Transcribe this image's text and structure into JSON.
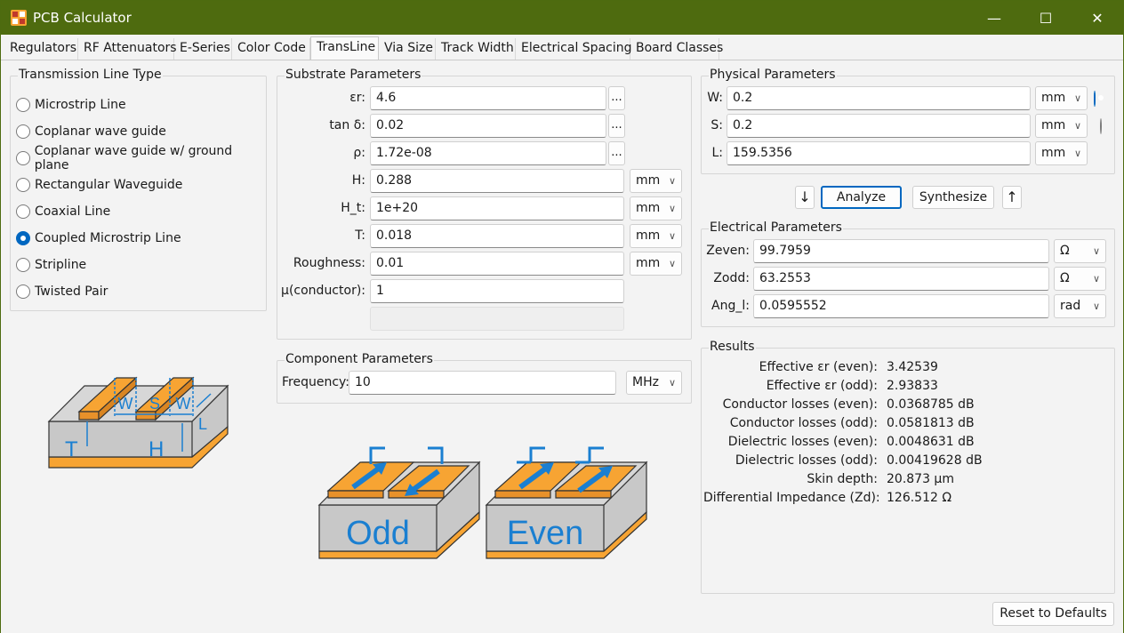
{
  "window": {
    "title": "PCB Calculator",
    "buttons": {
      "minimize": "—",
      "maximize": "☐",
      "close": "✕"
    }
  },
  "tabs": [
    "Regulators",
    "RF Attenuators",
    "E-Series",
    "Color Code",
    "TransLine",
    "Via Size",
    "Track Width",
    "Electrical Spacing",
    "Board Classes"
  ],
  "active_tab": "TransLine",
  "line_type": {
    "title": "Transmission Line Type",
    "options": [
      "Microstrip Line",
      "Coplanar wave guide",
      "Coplanar wave guide w/ ground plane",
      "Rectangular Waveguide",
      "Coaxial Line",
      "Coupled Microstrip Line",
      "Stripline",
      "Twisted Pair"
    ],
    "selected": "Coupled Microstrip Line"
  },
  "diagram_coupled": {
    "w1": "W",
    "s": "S",
    "w2": "W",
    "l": "L",
    "t": "T",
    "h": "H"
  },
  "diagram_modes": {
    "odd": "Odd",
    "even": "Even"
  },
  "substrate": {
    "title": "Substrate Parameters",
    "rows": [
      {
        "label": "εr:",
        "value": "4.6",
        "extra": "..."
      },
      {
        "label": "tan δ:",
        "value": "0.02",
        "extra": "..."
      },
      {
        "label": "ρ:",
        "value": "1.72e-08",
        "extra": "..."
      },
      {
        "label": "H:",
        "value": "0.288",
        "unit": "mm"
      },
      {
        "label": "H_t:",
        "value": "1e+20",
        "unit": "mm"
      },
      {
        "label": "T:",
        "value": "0.018",
        "unit": "mm"
      },
      {
        "label": "Roughness:",
        "value": "0.01",
        "unit": "mm"
      },
      {
        "label": "μ(conductor):",
        "value": "1"
      }
    ]
  },
  "component": {
    "title": "Component Parameters",
    "freq_label": "Frequency:",
    "freq_value": "10",
    "freq_unit": "MHz"
  },
  "physical": {
    "title": "Physical Parameters",
    "rows": [
      {
        "label": "W:",
        "value": "0.2",
        "unit": "mm",
        "radio": true
      },
      {
        "label": "S:",
        "value": "0.2",
        "unit": "mm",
        "radio": false
      },
      {
        "label": "L:",
        "value": "159.5356",
        "unit": "mm"
      }
    ]
  },
  "actions": {
    "analyze": "Analyze",
    "synthesize": "Synthesize",
    "down_arrow": "↓",
    "up_arrow": "↑"
  },
  "electrical": {
    "title": "Electrical Parameters",
    "rows": [
      {
        "label": "Zeven:",
        "value": "99.7959",
        "unit": "Ω"
      },
      {
        "label": "Zodd:",
        "value": "63.2553",
        "unit": "Ω"
      },
      {
        "label": "Ang_l:",
        "value": "0.0595552",
        "unit": "rad"
      }
    ]
  },
  "results": {
    "title": "Results",
    "rows": [
      {
        "label": "Effective εr (even):",
        "value": "3.42539"
      },
      {
        "label": "Effective εr (odd):",
        "value": "2.93833"
      },
      {
        "label": "Conductor losses (even):",
        "value": "0.0368785 dB"
      },
      {
        "label": "Conductor losses (odd):",
        "value": "0.0581813 dB"
      },
      {
        "label": "Dielectric losses (even):",
        "value": "0.0048631 dB"
      },
      {
        "label": "Dielectric losses (odd):",
        "value": "0.00419628 dB"
      },
      {
        "label": "Skin depth:",
        "value": "20.873 µm"
      },
      {
        "label": "Differential Impedance (Zd):",
        "value": "126.512 Ω"
      }
    ]
  },
  "reset_label": "Reset to Defaults",
  "colors": {
    "titlebar": "#4e6b0f",
    "accent": "#0067c0",
    "copper": "#f7a433",
    "diagram_blue": "#1a7fd1"
  }
}
